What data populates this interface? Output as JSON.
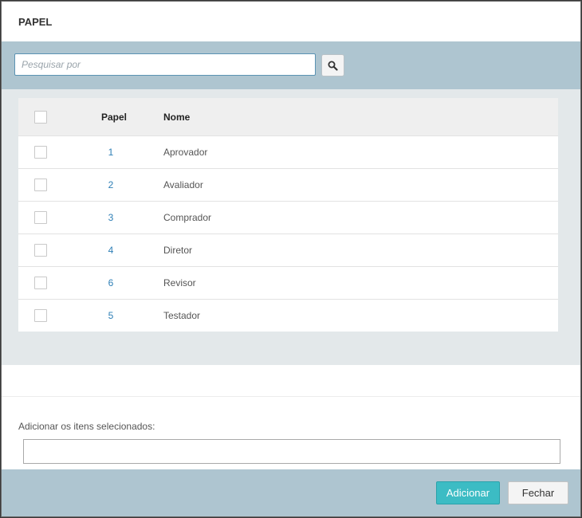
{
  "dialog": {
    "title": "PAPEL"
  },
  "search": {
    "placeholder": "Pesquisar por",
    "value": ""
  },
  "table": {
    "headers": {
      "papel": "Papel",
      "nome": "Nome"
    },
    "rows": [
      {
        "id": "1",
        "name": "Aprovador"
      },
      {
        "id": "2",
        "name": "Avaliador"
      },
      {
        "id": "3",
        "name": "Comprador"
      },
      {
        "id": "4",
        "name": "Diretor"
      },
      {
        "id": "6",
        "name": "Revisor"
      },
      {
        "id": "5",
        "name": "Testador"
      }
    ]
  },
  "selection": {
    "label": "Adicionar os itens selecionados:",
    "value": ""
  },
  "footer": {
    "add_label": "Adicionar",
    "close_label": "Fechar"
  },
  "colors": {
    "bar_background": "#aec5d0",
    "list_background": "#e3e8ea",
    "link": "#2e7fb6",
    "primary_button": "#3cbcc4"
  }
}
